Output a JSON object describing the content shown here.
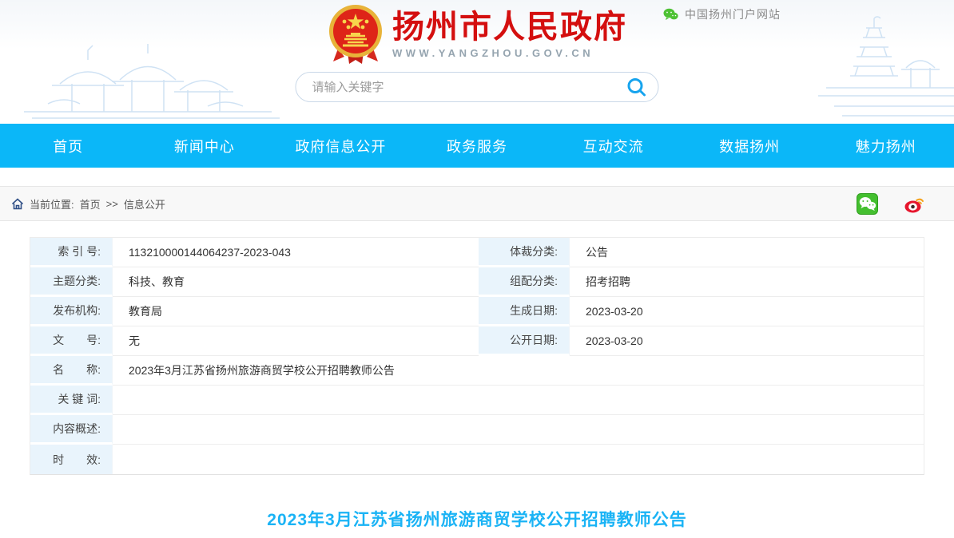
{
  "header": {
    "site_title": "扬州市人民政府",
    "site_url": "WWW.YANGZHOU.GOV.CN",
    "portal_label": "中国扬州门户网站",
    "search_placeholder": "请输入关键字"
  },
  "nav": {
    "items": [
      {
        "label": "首页"
      },
      {
        "label": "新闻中心"
      },
      {
        "label": "政府信息公开"
      },
      {
        "label": "政务服务"
      },
      {
        "label": "互动交流"
      },
      {
        "label": "数据扬州"
      },
      {
        "label": "魅力扬州"
      }
    ]
  },
  "breadcrumb": {
    "prefix": "当前位置:",
    "home": "首页",
    "separator": ">>",
    "current": "信息公开"
  },
  "info_table": {
    "rows_two_col": [
      {
        "label_left": "索 引 号:",
        "value_left": "113210000144064237-2023-043",
        "label_right": "体裁分类:",
        "value_right": "公告"
      },
      {
        "label_left": "主题分类:",
        "value_left": "科技、教育",
        "label_right": "组配分类:",
        "value_right": "招考招聘"
      },
      {
        "label_left": "发布机构:",
        "value_left": "教育局",
        "label_right": "生成日期:",
        "value_right": "2023-03-20"
      },
      {
        "label_left": "文　　号:",
        "value_left": "无",
        "label_right": "公开日期:",
        "value_right": "2023-03-20"
      }
    ],
    "rows_full_width": [
      {
        "label": "名　　称:",
        "value": "2023年3月江苏省扬州旅游商贸学校公开招聘教师公告"
      },
      {
        "label": "关 键 词:",
        "value": ""
      },
      {
        "label": "内容概述:",
        "value": ""
      },
      {
        "label": "时　　效:",
        "value": ""
      }
    ]
  },
  "article": {
    "title": "2023年3月江苏省扬州旅游商贸学校公开招聘教师公告"
  },
  "colors": {
    "nav_cyan": "#0bb7f8",
    "site_title_red": "#d40f0f",
    "article_title_cyan": "#1ab3f5",
    "label_cell_blue": "#e9f4fc",
    "wechat_green": "#4ec234",
    "weibo_red": "#e6162d"
  }
}
